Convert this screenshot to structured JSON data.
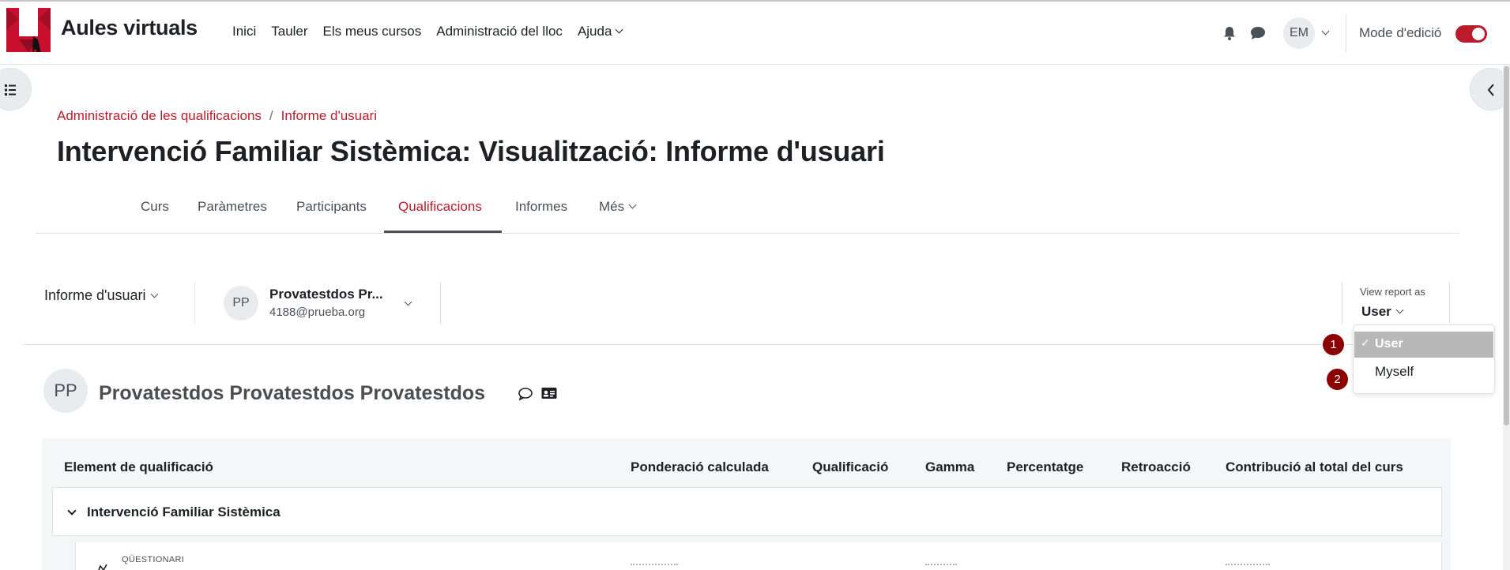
{
  "navbar": {
    "brand": "Aules virtuals",
    "links": [
      "Inici",
      "Tauler",
      "Els meus cursos",
      "Administració del lloc",
      "Ajuda"
    ],
    "avatar_initials": "EM",
    "edit_mode_label": "Mode d'edició",
    "edit_mode_on": true
  },
  "breadcrumb": [
    "Administració de les qualificacions",
    "Informe d'usuari"
  ],
  "page_title": "Intervenció Familiar Sistèmica: Visualització: Informe d'usuari",
  "secondary_nav": {
    "tabs": [
      "Curs",
      "Paràmetres",
      "Participants",
      "Qualificacions",
      "Informes",
      "Més"
    ],
    "active": "Qualificacions"
  },
  "action_bar": {
    "report_selector": "Informe d'usuari",
    "selected_user": {
      "initials": "PP",
      "name": "Provatestdos Pr...",
      "email": "4188@prueba.org"
    },
    "view_as_label": "View report as",
    "view_as_value": "User",
    "view_as_options": [
      {
        "label": "User",
        "selected": true,
        "badge": "1"
      },
      {
        "label": "Myself",
        "selected": false,
        "badge": "2"
      }
    ]
  },
  "user_heading": {
    "initials": "PP",
    "full_name": "Provatestdos Provatestdos Provatestdos"
  },
  "table": {
    "headers": [
      "Element de qualificació",
      "Ponderació calculada",
      "Qualificació",
      "Gamma",
      "Percentatge",
      "Retroacció",
      "Contribució al total del curs"
    ],
    "category": "Intervenció Familiar Sistèmica",
    "first_item_type": "QÜESTIONARI"
  },
  "colors": {
    "brand_red": "#ba1c2b",
    "badge": "#8b0000",
    "menu_selected_bg": "#b8b8b8"
  }
}
